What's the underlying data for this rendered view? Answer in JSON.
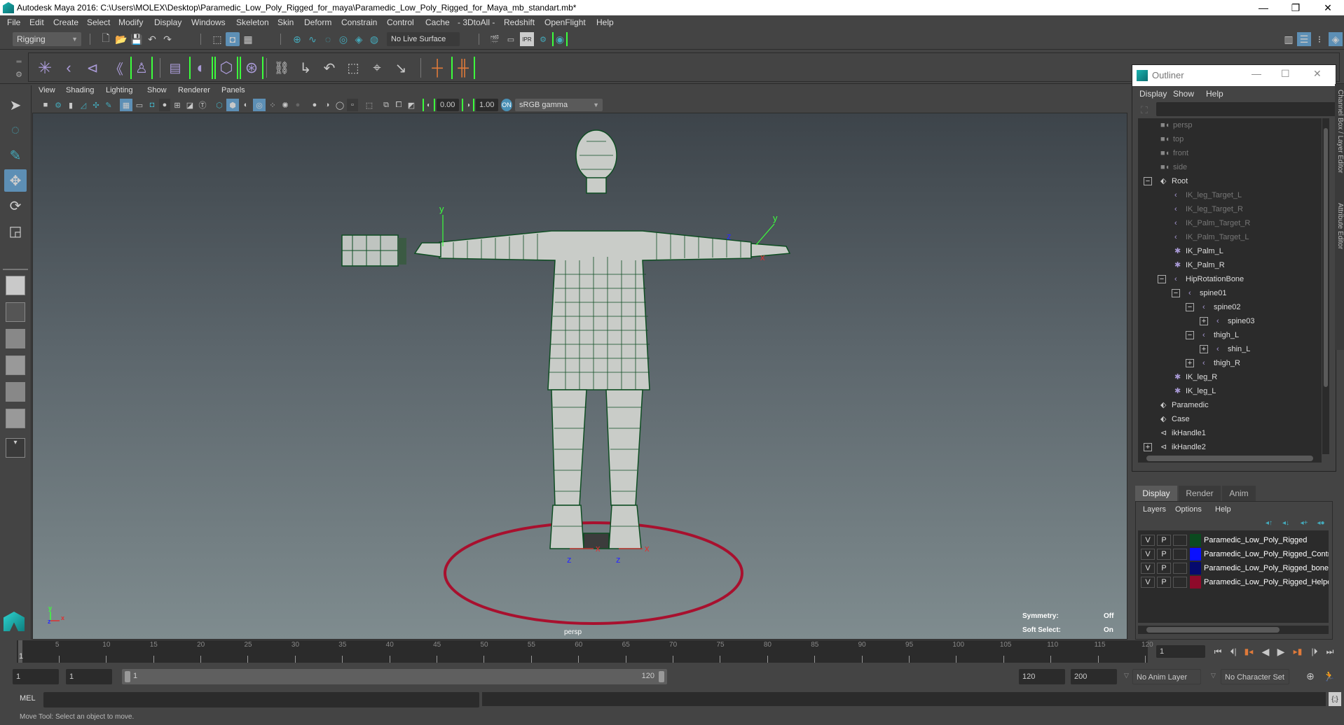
{
  "window": {
    "title": "Autodesk Maya 2016: C:\\Users\\MOLEX\\Desktop\\Paramedic_Low_Poly_Rigged_for_maya\\Paramedic_Low_Poly_Rigged_for_Maya_mb_standart.mb*",
    "minimize": "—",
    "maximize": "❐",
    "close": "✕"
  },
  "menubar": [
    "File",
    "Edit",
    "Create",
    "Select",
    "Modify",
    "Display",
    "Windows",
    "Skeleton",
    "Skin",
    "Deform",
    "Constrain",
    "Control",
    "Cache",
    "- 3DtoAll -",
    "Redshift",
    "OpenFlight",
    "Help"
  ],
  "toolbar": {
    "menuset": "Rigging",
    "live_surface": "No Live Surface",
    "render_icons": [
      "render-view",
      "render-frame",
      "ipr-render",
      "render-settings",
      "hypershade"
    ],
    "ipr_label": "IPR"
  },
  "shelf": {
    "icons": [
      "joint-tool",
      "ik-handle",
      "ik-spline-handle",
      "insert-joint",
      "quick-rig",
      "paint-skin-weights",
      "smooth-bind",
      "interactive-bind",
      "hik-skeleton",
      "parent-constraint",
      "point-constraint",
      "orient-constraint",
      "scale-constraint",
      "aim-constraint",
      "pole-vector-constraint",
      "hik-character",
      "hik-controls"
    ]
  },
  "viewport": {
    "menu": [
      "View",
      "Shading",
      "Lighting",
      "Show",
      "Renderer",
      "Panels"
    ],
    "exposure": "0.00",
    "gamma": "1.00",
    "color_space": "sRGB gamma",
    "camera_label": "persp",
    "hud": {
      "symmetry_label": "Symmetry:",
      "symmetry_value": "Off",
      "soft_select_label": "Soft Select:",
      "soft_select_value": "On"
    },
    "axes": {
      "x": "x",
      "y": "y",
      "z": "z"
    }
  },
  "timeline": {
    "ticks": [
      5,
      10,
      15,
      20,
      25,
      30,
      35,
      40,
      45,
      50,
      55,
      60,
      65,
      70,
      75,
      80,
      85,
      90,
      95,
      100,
      105,
      110,
      115,
      120
    ],
    "current_frame_marker": "1",
    "current_frame": "1"
  },
  "range": {
    "start": "1",
    "playback_start": "1",
    "slider_start": "1",
    "slider_end": "120",
    "playback_end": "120",
    "end": "200",
    "anim_layer": "No Anim Layer",
    "character_set": "No Character Set"
  },
  "playback": [
    "go-to-start",
    "step-back-key",
    "step-back-frame",
    "play-backwards",
    "play-forwards",
    "step-forward-frame",
    "step-forward-key",
    "go-to-end"
  ],
  "command_line": {
    "label": "MEL",
    "value": ""
  },
  "status": {
    "help_line": "Move Tool: Select an object to move."
  },
  "outliner": {
    "title": "Outliner",
    "menu": [
      "Display",
      "Show",
      "Help"
    ],
    "search": "",
    "items": [
      {
        "label": "persp",
        "icon": "camera",
        "depth": 0,
        "dim": true,
        "expander": ""
      },
      {
        "label": "top",
        "icon": "camera",
        "depth": 0,
        "dim": true,
        "expander": ""
      },
      {
        "label": "front",
        "icon": "camera",
        "depth": 0,
        "dim": true,
        "expander": ""
      },
      {
        "label": "side",
        "icon": "camera",
        "depth": 0,
        "dim": true,
        "expander": ""
      },
      {
        "label": "Root",
        "icon": "mesh",
        "depth": 0,
        "dim": false,
        "expander": "−"
      },
      {
        "label": "IK_leg_Target_L",
        "icon": "joint",
        "depth": 1,
        "dim": true,
        "expander": ""
      },
      {
        "label": "IK_leg_Target_R",
        "icon": "joint",
        "depth": 1,
        "dim": true,
        "expander": ""
      },
      {
        "label": "IK_Palm_Target_R",
        "icon": "joint",
        "depth": 1,
        "dim": true,
        "expander": ""
      },
      {
        "label": "IK_Palm_Target_L",
        "icon": "joint",
        "depth": 1,
        "dim": true,
        "expander": ""
      },
      {
        "label": "IK_Palm_L",
        "icon": "locator",
        "depth": 1,
        "dim": false,
        "expander": ""
      },
      {
        "label": "IK_Palm_R",
        "icon": "locator",
        "depth": 1,
        "dim": false,
        "expander": ""
      },
      {
        "label": "HipRotationBone",
        "icon": "joint",
        "depth": 1,
        "dim": false,
        "expander": "−"
      },
      {
        "label": "spine01",
        "icon": "joint",
        "depth": 2,
        "dim": false,
        "expander": "−"
      },
      {
        "label": "spine02",
        "icon": "joint",
        "depth": 3,
        "dim": false,
        "expander": "−"
      },
      {
        "label": "spine03",
        "icon": "joint",
        "depth": 4,
        "dim": false,
        "expander": "+"
      },
      {
        "label": "thigh_L",
        "icon": "joint",
        "depth": 3,
        "dim": false,
        "expander": "−"
      },
      {
        "label": "shin_L",
        "icon": "joint",
        "depth": 4,
        "dim": false,
        "expander": "+"
      },
      {
        "label": "thigh_R",
        "icon": "joint",
        "depth": 3,
        "dim": false,
        "expander": "+"
      },
      {
        "label": "IK_leg_R",
        "icon": "locator",
        "depth": 1,
        "dim": false,
        "expander": ""
      },
      {
        "label": "IK_leg_L",
        "icon": "locator",
        "depth": 1,
        "dim": false,
        "expander": ""
      },
      {
        "label": "Paramedic",
        "icon": "mesh",
        "depth": 0,
        "dim": false,
        "expander": ""
      },
      {
        "label": "Case",
        "icon": "mesh",
        "depth": 0,
        "dim": false,
        "expander": ""
      },
      {
        "label": "ikHandle1",
        "icon": "ik-handle",
        "depth": 0,
        "dim": false,
        "expander": ""
      },
      {
        "label": "ikHandle2",
        "icon": "ik-handle",
        "depth": 0,
        "dim": false,
        "expander": "+"
      }
    ]
  },
  "side_tabs": [
    "Channel Box / Layer Editor",
    "Attribute Editor"
  ],
  "layer_editor": {
    "tabs": [
      "Display",
      "Render",
      "Anim"
    ],
    "active_tab": "Display",
    "menu": [
      "Layers",
      "Options",
      "Help"
    ],
    "layers": [
      {
        "v": "V",
        "p": "P",
        "color": "#0b4a1f",
        "name": "Paramedic_Low_Poly_Rigged"
      },
      {
        "v": "V",
        "p": "P",
        "color": "#0a10ff",
        "name": "Paramedic_Low_Poly_Rigged_Contr"
      },
      {
        "v": "V",
        "p": "P",
        "color": "#050a6e",
        "name": "Paramedic_Low_Poly_Rigged_bones"
      },
      {
        "v": "V",
        "p": "P",
        "color": "#8e0a2a",
        "name": "Paramedic_Low_Poly_Rigged_Helpe"
      }
    ]
  },
  "colors": {
    "accent_blue": "#5d8fb5",
    "green_highlight": "#3cff3c",
    "control_circle": "#a8102e",
    "mesh_wire": "#0e4d22",
    "joint_purple": "#a99ad6",
    "key_orange": "#e07a3a"
  }
}
